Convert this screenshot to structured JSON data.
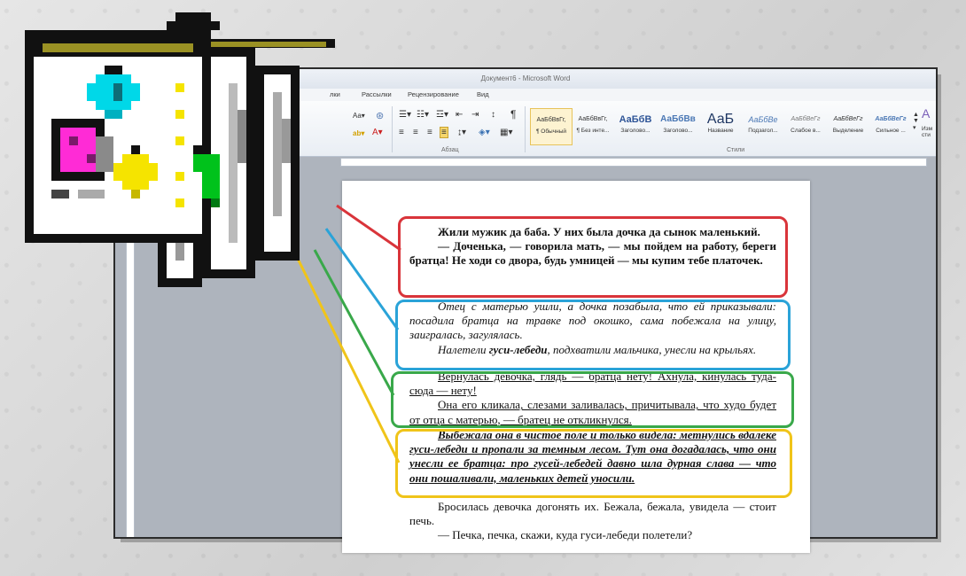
{
  "window": {
    "title": "Документ6 - Microsoft Word",
    "tabs": [
      "лки",
      "Рассылки",
      "Рецензирование",
      "Вид"
    ]
  },
  "ribbon": {
    "paragraph_group_label": "Абзац",
    "styles_group_label": "Стили",
    "styles": [
      {
        "sample": "АаБбВвГг,",
        "name": "¶ Обычный"
      },
      {
        "sample": "АаБбВвГг,",
        "name": "¶ Без инте..."
      },
      {
        "sample": "АаБбВ",
        "name": "Заголово..."
      },
      {
        "sample": "АаБбВв",
        "name": "Заголово..."
      },
      {
        "sample": "АаБ",
        "name": "Название"
      },
      {
        "sample": "АаБбВе",
        "name": "Подзагол..."
      },
      {
        "sample": "АаБбВеГг",
        "name": "Слабое в..."
      },
      {
        "sample": "АаБбВеГг",
        "name": "Выделение"
      },
      {
        "sample": "АаБбВеГг",
        "name": "Сильное ..."
      }
    ],
    "overflow_label": "Изм сти",
    "font_size_label": "Aa▾",
    "pilcrow": "¶"
  },
  "colors": {
    "red": "#d9343a",
    "blue": "#2aa3d8",
    "green": "#39a84a",
    "yellow": "#f0c419"
  },
  "document": {
    "red_p1": "Жили мужик да баба. У них была дочка да сынок маленький.",
    "red_p2": "— Доченька, — говорила мать, — мы пойдем на работу, береги братца! Не ходи со двора, будь умницей — мы купим тебе платочек.",
    "blue_p1": "Отец с матерью ушли, а дочка позабыла, что ей приказывали: посадила братца на травке под окошко, сама побежала на улицу, заигралась, загулялась.",
    "blue_p2_a": "Налетели ",
    "blue_p2_b": "гуси-лебеди",
    "blue_p2_c": ", подхватили мальчика, унесли на крыльях.",
    "green_p1": "Вернулась девочка, глядь — братца нету! Ахнула, кинулась туда-сюда — нету!",
    "green_p2": "Она его кликала, слезами заливалась, причитывала, что худо будет от отца с матерью, — братец не откликнулся.",
    "yellow_p1": "Выбежала она в чистое поле и только видела: метнулись вдалеке гуси-лебеди и пропали за темным лесом. Тут она догадалась, что они унесли ее братца: про гусей-лебедей давно шла дурная слава — что они пошаливали, маленьких детей уносили.",
    "plain_p1": "Бросилась девочка догонять их. Бежала, бежала, увидела — стоит печь.",
    "plain_p2": "— Печка, печка, скажи, куда гуси-лебеди полетели?"
  }
}
